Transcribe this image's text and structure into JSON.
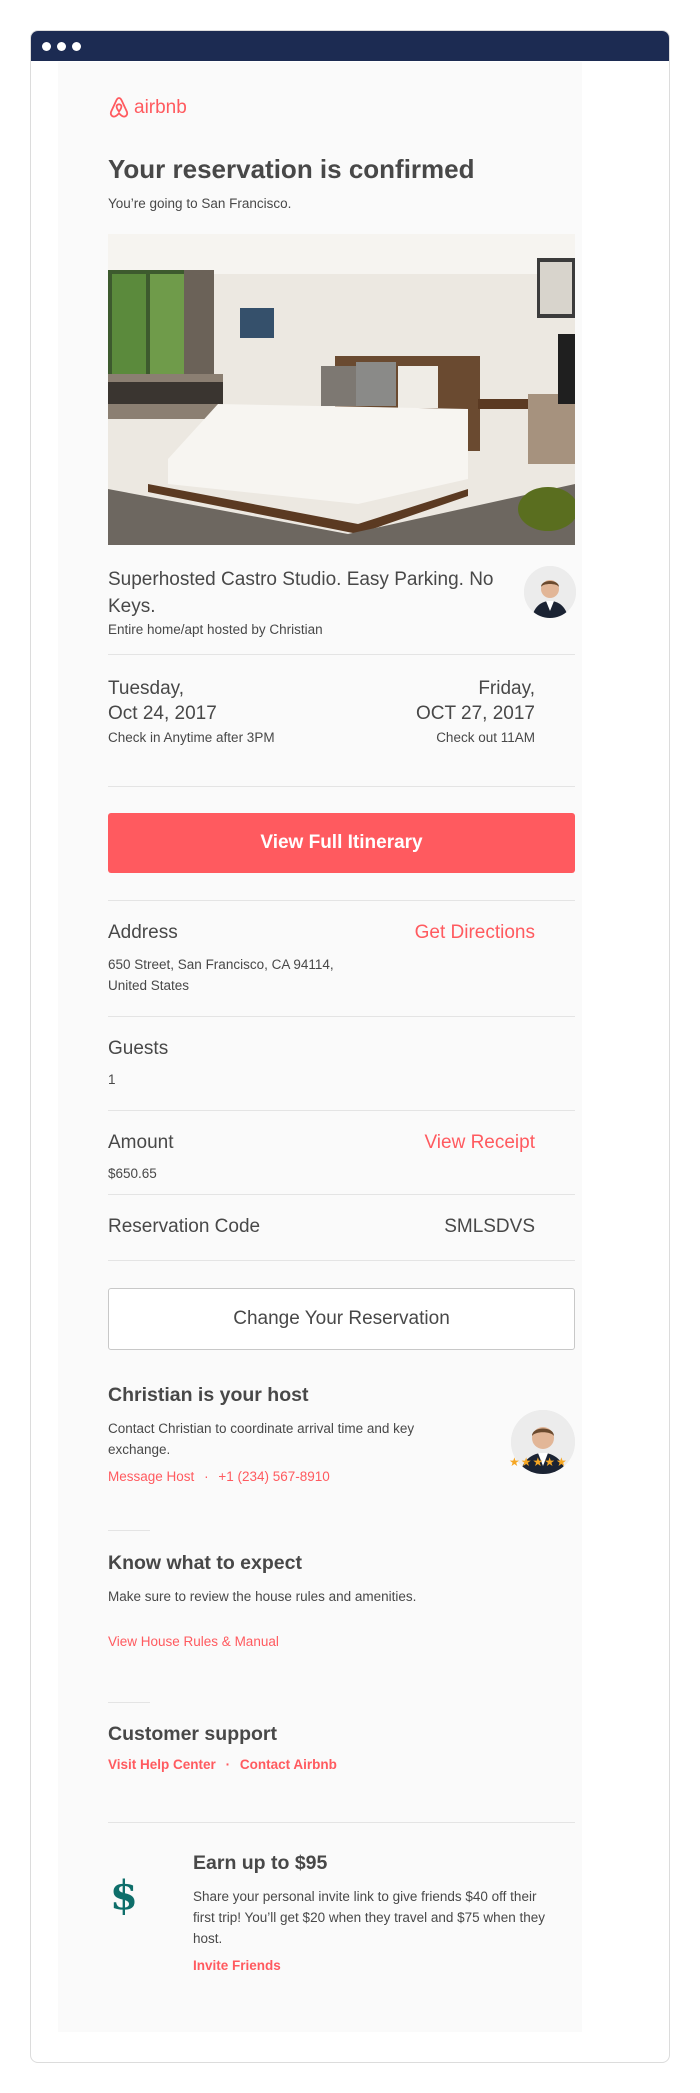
{
  "brand": {
    "logo_text": "airbnb",
    "accent": "#ff5a5f",
    "titlebar_color": "#1c2b52"
  },
  "header": {
    "title": "Your reservation is confirmed",
    "subtitle": "You’re going to San Francisco."
  },
  "listing": {
    "title": "Superhosted Castro Studio. Easy Parking. No Keys.",
    "subtitle": "Entire home/apt hosted by Christian"
  },
  "checkin": {
    "day": "Tuesday,",
    "date": "Oct 24, 2017",
    "note": "Check in Anytime after 3PM"
  },
  "checkout": {
    "day": "Friday,",
    "date": "OCT 27, 2017",
    "note": "Check out 11AM"
  },
  "itinerary_button": "View Full Itinerary",
  "address": {
    "label": "Address",
    "link": "Get Directions",
    "value": "650 Street, San Francisco, CA 94114, United States"
  },
  "guests": {
    "label": "Guests",
    "value": "1"
  },
  "amount": {
    "label": "Amount",
    "link": "View Receipt",
    "value": "$650.65"
  },
  "reservation_code": {
    "label": "Reservation Code",
    "value": "SMLSDVS"
  },
  "change_button": "Change Your Reservation",
  "host": {
    "heading": "Christian is your host",
    "text": "Contact Christian to coordinate arrival time and key exchange.",
    "message_link": "Message Host",
    "separator": "·",
    "phone": "+1 (234) 567-8910",
    "rating": 5,
    "stars": "★★★★★"
  },
  "expect": {
    "heading": "Know what to expect",
    "text": "Make sure to review the house rules and amenities.",
    "link": "View House Rules & Manual"
  },
  "support": {
    "heading": "Customer support",
    "help_link": "Visit Help Center",
    "separator": "·",
    "contact_link": "Contact Airbnb"
  },
  "referral": {
    "icon": "dollar-icon",
    "symbol": "$",
    "heading": "Earn up to $95",
    "text": "Share your personal invite link to give friends $40 off their first trip! You’ll get $20 when they travel and $75 when they host.",
    "link": "Invite Friends"
  }
}
